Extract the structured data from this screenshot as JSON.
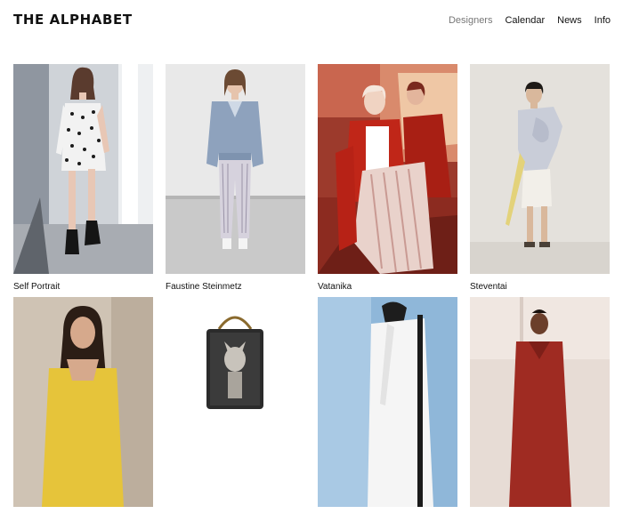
{
  "header": {
    "logo": "THE ALPHABET",
    "nav": [
      {
        "label": "Designers",
        "active": true
      },
      {
        "label": "Calendar",
        "active": false
      },
      {
        "label": "News",
        "active": false
      },
      {
        "label": "Info",
        "active": false
      }
    ]
  },
  "designers": [
    {
      "name": "Self Portrait",
      "image": "runway-photo"
    },
    {
      "name": "Faustine Steinmetz",
      "image": "runway-photo"
    },
    {
      "name": "Vatanika",
      "image": "editorial-photo"
    },
    {
      "name": "Steventai",
      "image": "lookbook-photo"
    },
    {
      "name": "",
      "image": "portrait-photo"
    },
    {
      "name": "",
      "image": "bag-photo"
    },
    {
      "name": "",
      "image": "lookbook-photo"
    },
    {
      "name": "",
      "image": "lookbook-photo"
    }
  ]
}
